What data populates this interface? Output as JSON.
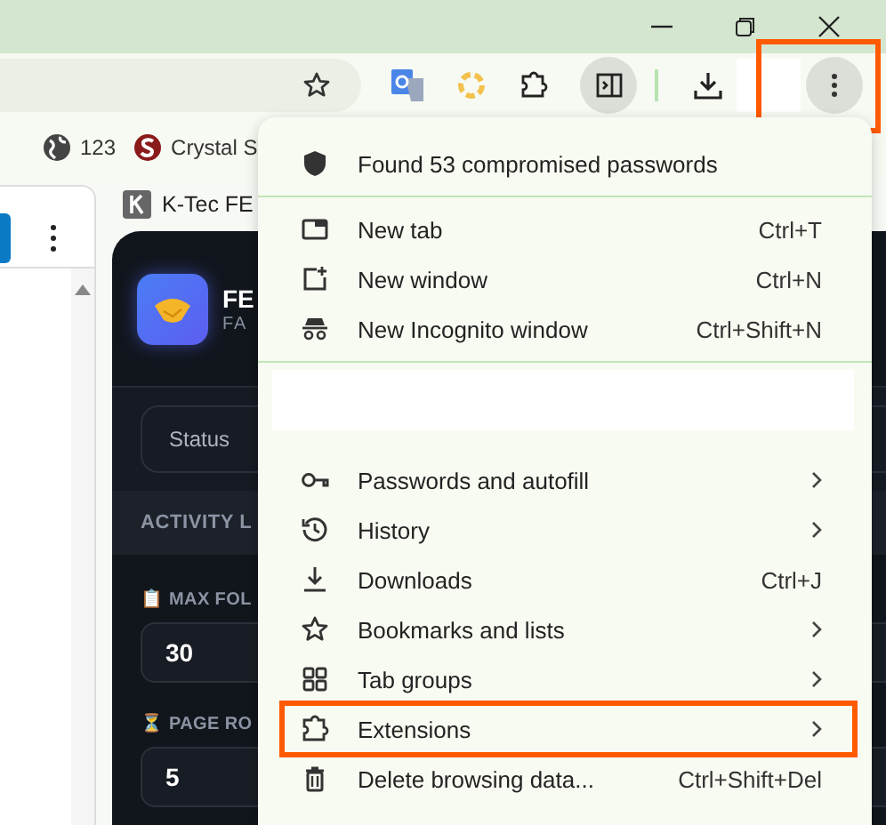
{
  "toolbar": {
    "menu_button": {
      "highlighted": true
    }
  },
  "bookmarks": [
    {
      "label": "123"
    },
    {
      "label": "Crystal S"
    }
  ],
  "page": {
    "tab_title": "K-Tec FE",
    "app": {
      "title": "FE",
      "subtitle": "FA",
      "status_label": "Status",
      "section": "ACTIVITY L",
      "fields": [
        {
          "label": "MAX FOL",
          "value": "30",
          "emoji": "📋"
        },
        {
          "label": "PAGE RO",
          "value": "5",
          "emoji": "⏳"
        }
      ]
    }
  },
  "menu": {
    "sections": [
      [
        {
          "label": "Found 53 compromised passwords",
          "highlighted": false
        }
      ],
      [
        {
          "label": "New tab",
          "shortcut": "Ctrl+T",
          "highlighted": false
        },
        {
          "label": "New window",
          "shortcut": "Ctrl+N",
          "highlighted": false
        },
        {
          "label": "New Incognito window",
          "shortcut": "Ctrl+Shift+N",
          "highlighted": false
        }
      ],
      [
        {
          "kind": "blank"
        },
        {
          "label": "Passwords and autofill",
          "submenu": true,
          "highlighted": false
        },
        {
          "label": "History",
          "submenu": true,
          "highlighted": false
        },
        {
          "label": "Downloads",
          "shortcut": "Ctrl+J",
          "highlighted": false
        },
        {
          "label": "Bookmarks and lists",
          "submenu": true,
          "highlighted": false
        },
        {
          "label": "Tab groups",
          "submenu": true,
          "highlighted": false
        },
        {
          "label": "Extensions",
          "submenu": true,
          "highlighted": true
        },
        {
          "label": "Delete browsing data...",
          "shortcut": "Ctrl+Shift+Del",
          "highlighted": false
        }
      ]
    ]
  }
}
